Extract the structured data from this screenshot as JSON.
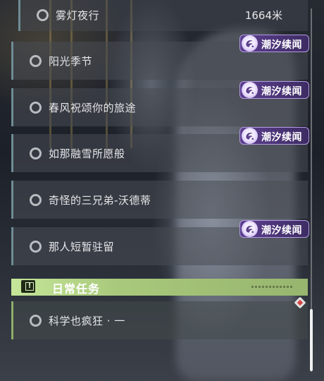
{
  "quests": [
    {
      "title": "雾灯夜行",
      "distance": "1664米"
    },
    {
      "title": "阳光季节",
      "badge": "潮汐续闻"
    },
    {
      "title": "春风祝颂你的旅途",
      "badge": "潮汐续闻"
    },
    {
      "title": "如那融雪所愿般",
      "badge": "潮汐续闻"
    },
    {
      "title": "奇怪的三兄弟-沃德蒂"
    },
    {
      "title": "那人短暂驻留",
      "badge": "潮汐续闻"
    }
  ],
  "daily_section": {
    "title": "日常任务",
    "icon": "exclamation-box-icon",
    "color": "#b5d68a",
    "quests": [
      {
        "title": "科学也疯狂 · 一"
      }
    ]
  },
  "badge_color": "#5c3f8f",
  "tracker_icon": "red-diamond-marker-icon"
}
